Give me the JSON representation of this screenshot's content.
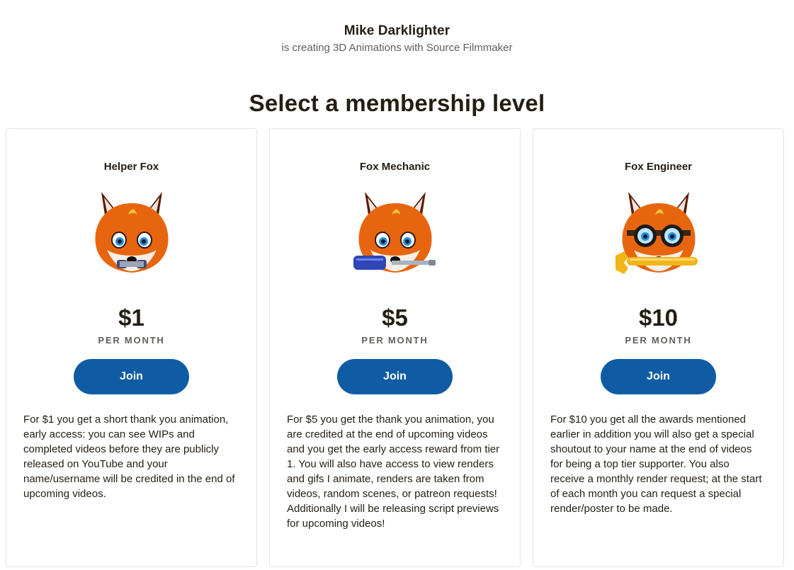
{
  "creator": {
    "name": "Mike Darklighter",
    "tagline": "is creating 3D Animations with Source Filmmaker"
  },
  "page_title": "Select a membership level",
  "tiers": [
    {
      "name": "Helper Fox",
      "price": "$1",
      "period": "PER MONTH",
      "button": "Join",
      "image": "fox-mascot-holding-screw",
      "description": "For $1 you get a short thank you animation, early access: you can see WIPs and completed videos before they are publicly released on YouTube and your name/username will be credited in the end of upcoming videos."
    },
    {
      "name": "Fox Mechanic",
      "price": "$5",
      "period": "PER MONTH",
      "button": "Join",
      "image": "fox-mascot-holding-screwdriver",
      "description": "For $5 you get the thank you animation, you are credited at the end of upcoming videos and you get the early access reward from tier 1. You will also have access to view renders and gifs I animate, renders are taken from videos, random scenes, or patreon requests! Additionally I will be releasing script previews for upcoming videos!"
    },
    {
      "name": "Fox Engineer",
      "price": "$10",
      "period": "PER MONTH",
      "button": "Join",
      "image": "fox-mascot-goggles-wrench",
      "description": "For $10 you get all the awards mentioned earlier in addition you will also get a special shoutout to your name at the end of videos for being a top tier supporter. You also receive a monthly render request; at the start of each month you can request a special render/poster to be made."
    }
  ],
  "colors": {
    "button": "#0f5ca4",
    "text": "#241e12",
    "muted": "#5f5e5b",
    "card_border": "#e5e3dd",
    "fox_orange": "#e8650f"
  }
}
